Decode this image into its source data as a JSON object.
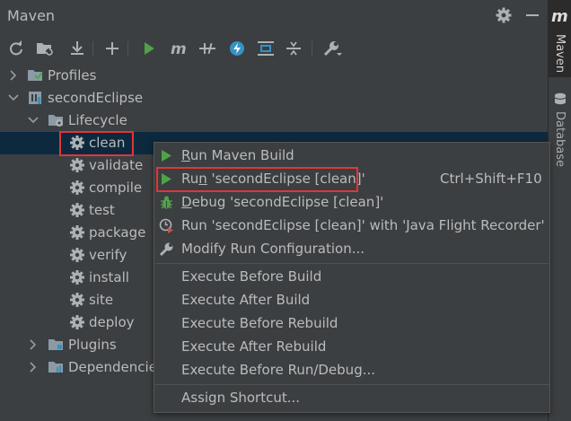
{
  "panel": {
    "title": "Maven",
    "settings_icon": "gear-icon",
    "hide_icon": "minus-icon"
  },
  "toolbar": {
    "icons": [
      "reload-icon",
      "add-project-icon",
      "download-icon",
      "plus-icon",
      "run-icon",
      "maven-goal-icon",
      "toggle-offline-icon",
      "skip-tests-icon",
      "show-dependencies-icon",
      "collapse-all-icon",
      "settings-wrench-icon"
    ]
  },
  "tree": {
    "profiles": "Profiles",
    "project": "secondEclipse",
    "lifecycle": "Lifecycle",
    "goals": [
      "clean",
      "validate",
      "compile",
      "test",
      "package",
      "verify",
      "install",
      "site",
      "deploy"
    ],
    "plugins": "Plugins",
    "dependencies": "Dependencies"
  },
  "menu": {
    "run_maven_build": {
      "prefix": "",
      "mnemonic": "R",
      "rest": "un Maven Build"
    },
    "run_config": {
      "prefix": "Ru",
      "mnemonic": "n",
      "rest": " 'secondEclipse [clean]'",
      "shortcut": "Ctrl+Shift+F10"
    },
    "debug_config": {
      "prefix": "",
      "mnemonic": "D",
      "rest": "ebug 'secondEclipse [clean]'"
    },
    "run_jfr": "Run 'secondEclipse [clean]' with 'Java Flight Recorder'",
    "modify_run_config": "Modify Run Configuration...",
    "execute_before_build": "Execute Before Build",
    "execute_after_build": "Execute After Build",
    "execute_before_rebuild": "Execute Before Rebuild",
    "execute_after_rebuild": "Execute After Rebuild",
    "execute_before_run": "Execute Before Run/Debug...",
    "assign_shortcut": "Assign Shortcut..."
  },
  "strip": {
    "maven_tab": "Maven",
    "maven_glyph": "m",
    "database_tab": "Database"
  },
  "colors": {
    "background": "#3c3f41",
    "selection": "#0d293e",
    "highlight_box": "#e0363a",
    "run_green": "#4ea347"
  }
}
